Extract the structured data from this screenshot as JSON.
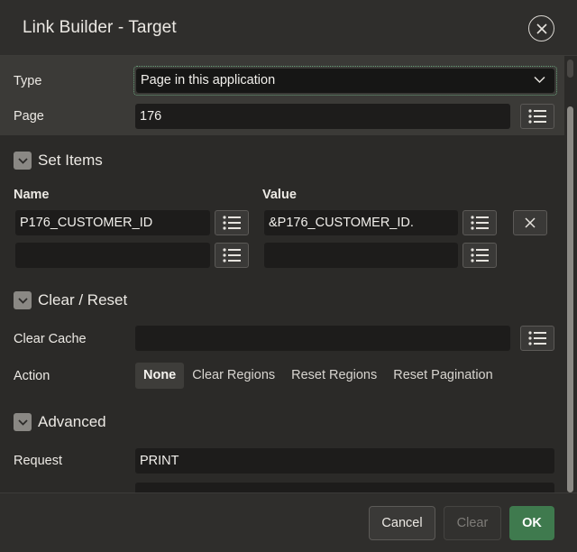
{
  "dialog": {
    "title": "Link Builder - Target"
  },
  "target": {
    "type_label": "Type",
    "type_value": "Page in this application",
    "page_label": "Page",
    "page_value": "176"
  },
  "set_items": {
    "section_title": "Set Items",
    "name_header": "Name",
    "value_header": "Value",
    "rows": [
      {
        "name": "P176_CUSTOMER_ID",
        "value": "&P176_CUSTOMER_ID."
      },
      {
        "name": "",
        "value": ""
      }
    ]
  },
  "clear_reset": {
    "section_title": "Clear / Reset",
    "clear_cache_label": "Clear Cache",
    "clear_cache_value": "",
    "action_label": "Action",
    "action_options": [
      "None",
      "Clear Regions",
      "Reset Regions",
      "Reset Pagination"
    ],
    "action_selected": "None"
  },
  "advanced": {
    "section_title": "Advanced",
    "request_label": "Request",
    "request_value": "PRINT"
  },
  "footer": {
    "cancel_label": "Cancel",
    "clear_label": "Clear",
    "ok_label": "OK"
  },
  "colors": {
    "ok_button": "#3f7a4e",
    "focus_outline": "#6aa27c"
  },
  "icons": {
    "close": "close-icon",
    "lov": "list-icon",
    "chevron": "chevron-down-icon",
    "section_toggle": "chevron-down-icon",
    "remove": "close-icon"
  }
}
